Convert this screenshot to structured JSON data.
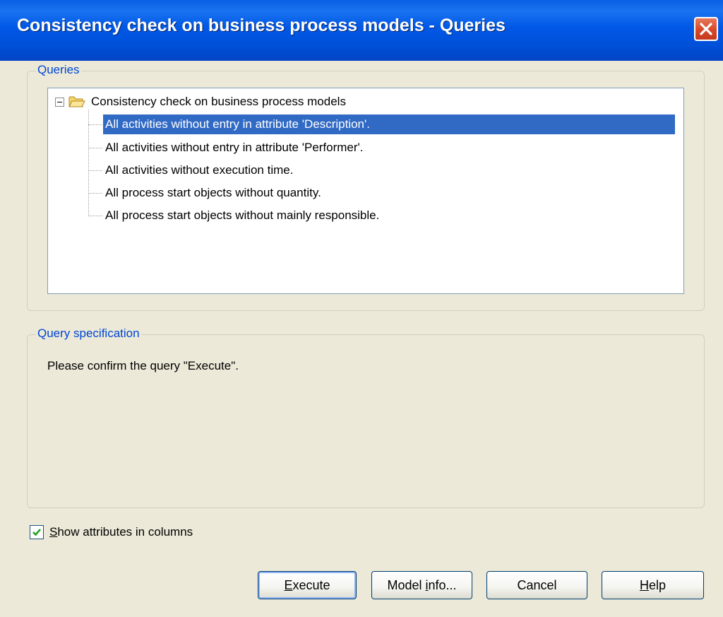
{
  "window": {
    "title": "Consistency check on business process models - Queries"
  },
  "queries": {
    "group_label": "Queries",
    "tree": {
      "root_label": "Consistency check on business process models",
      "items": [
        {
          "label": "All activities without entry in attribute 'Description'.",
          "selected": true
        },
        {
          "label": "All activities without entry in attribute 'Performer'.",
          "selected": false
        },
        {
          "label": "All activities without execution time.",
          "selected": false
        },
        {
          "label": "All process start objects without quantity.",
          "selected": false
        },
        {
          "label": "All process start objects without mainly responsible.",
          "selected": false
        }
      ]
    }
  },
  "specification": {
    "group_label": "Query specification",
    "text": "Please confirm the query \"Execute\"."
  },
  "options": {
    "show_attributes": {
      "underlined_char": "S",
      "rest": "how attributes in columns",
      "checked": true
    }
  },
  "buttons": {
    "execute": {
      "underlined_char": "E",
      "rest": "xecute"
    },
    "model_info": {
      "prefix": "Model ",
      "underlined_char": "i",
      "rest": "nfo..."
    },
    "cancel": {
      "label": "Cancel"
    },
    "help": {
      "underlined_char": "H",
      "rest": "elp"
    }
  },
  "colors": {
    "title_bar": "#0058e6",
    "selection": "#316ac5",
    "group_label": "#0046d5",
    "close_button": "#d94a2a"
  },
  "icons": {
    "close": "close-icon",
    "folder": "folder-open-icon",
    "expander": "tree-collapse-icon",
    "checkmark": "checkmark-icon"
  }
}
